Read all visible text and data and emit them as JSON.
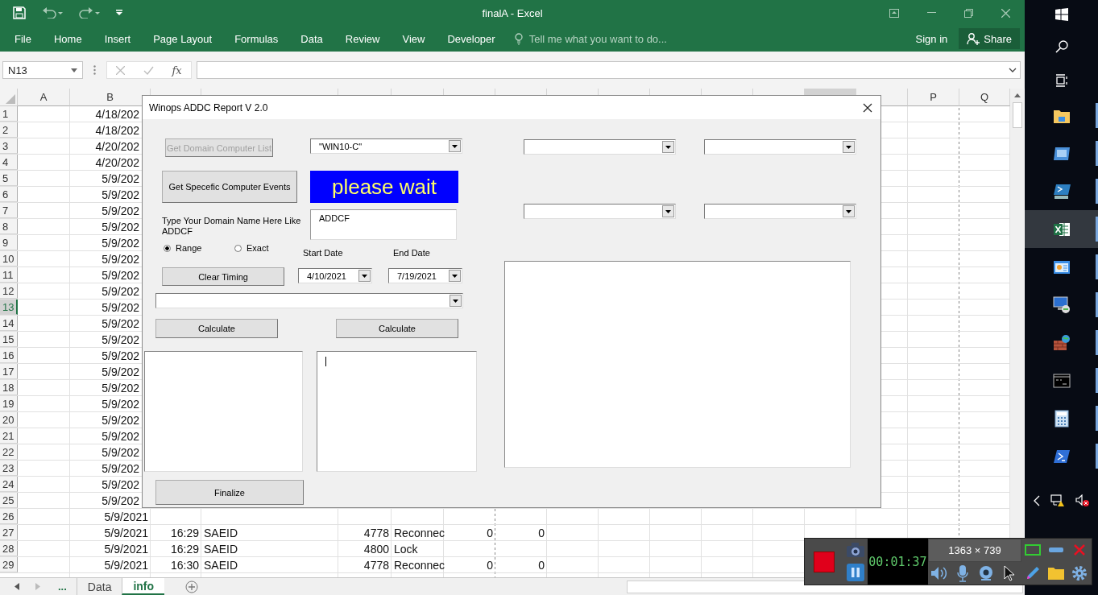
{
  "titlebar": {
    "title": "finalA - Excel"
  },
  "ribbon_tabs": [
    {
      "label": "File"
    },
    {
      "label": "Home"
    },
    {
      "label": "Insert"
    },
    {
      "label": "Page Layout"
    },
    {
      "label": "Formulas"
    },
    {
      "label": "Data"
    },
    {
      "label": "Review"
    },
    {
      "label": "View"
    },
    {
      "label": "Developer"
    }
  ],
  "tell_me": {
    "placeholder": "Tell me what you want to do..."
  },
  "account": {
    "sign_in": "Sign in",
    "share": "Share"
  },
  "formula_bar": {
    "name_box": "N13",
    "function_label": "fx"
  },
  "sheet": {
    "columns": [
      {
        "label": "A",
        "selected": false
      },
      {
        "label": "B",
        "selected": false
      },
      {
        "selected": false
      },
      {
        "selected": false
      },
      {
        "selected": false
      },
      {
        "selected": false
      },
      {
        "selected": false
      },
      {
        "selected": false
      },
      {
        "selected": false
      },
      {
        "selected": false
      },
      {
        "selected": false
      },
      {
        "selected": false
      },
      {
        "selected": false
      },
      {
        "selected": true
      },
      {
        "selected": false
      },
      {
        "label": "P",
        "selected": false
      },
      {
        "label": "Q",
        "selected": false
      }
    ],
    "rows": [
      {
        "number": "1",
        "selected": false,
        "cells": {
          "B": "4/18/202"
        }
      },
      {
        "number": "2",
        "selected": false,
        "cells": {
          "B": "4/18/202"
        }
      },
      {
        "number": "3",
        "selected": false,
        "cells": {
          "B": "4/20/202"
        }
      },
      {
        "number": "4",
        "selected": false,
        "cells": {
          "B": "4/20/202"
        }
      },
      {
        "number": "5",
        "selected": false,
        "cells": {
          "B": "5/9/202"
        }
      },
      {
        "number": "6",
        "selected": false,
        "cells": {
          "B": "5/9/202"
        }
      },
      {
        "number": "7",
        "selected": false,
        "cells": {
          "B": "5/9/202"
        }
      },
      {
        "number": "8",
        "selected": false,
        "cells": {
          "B": "5/9/202"
        }
      },
      {
        "number": "9",
        "selected": false,
        "cells": {
          "B": "5/9/202"
        }
      },
      {
        "number": "10",
        "selected": false,
        "cells": {
          "B": "5/9/202"
        }
      },
      {
        "number": "11",
        "selected": false,
        "cells": {
          "B": "5/9/202"
        }
      },
      {
        "number": "12",
        "selected": false,
        "cells": {
          "B": "5/9/202"
        }
      },
      {
        "number": "13",
        "selected": true,
        "cells": {
          "B": "5/9/202"
        }
      },
      {
        "number": "14",
        "selected": false,
        "cells": {
          "B": "5/9/202"
        }
      },
      {
        "number": "15",
        "selected": false,
        "cells": {
          "B": "5/9/202"
        }
      },
      {
        "number": "16",
        "selected": false,
        "cells": {
          "B": "5/9/202"
        }
      },
      {
        "number": "17",
        "selected": false,
        "cells": {
          "B": "5/9/202"
        }
      },
      {
        "number": "18",
        "selected": false,
        "cells": {
          "B": "5/9/202"
        }
      },
      {
        "number": "19",
        "selected": false,
        "cells": {
          "B": "5/9/202"
        }
      },
      {
        "number": "20",
        "selected": false,
        "cells": {
          "B": "5/9/202"
        }
      },
      {
        "number": "21",
        "selected": false,
        "cells": {
          "B": "5/9/202"
        }
      },
      {
        "number": "22",
        "selected": false,
        "cells": {
          "B": "5/9/202"
        }
      },
      {
        "number": "23",
        "selected": false,
        "cells": {
          "B": "5/9/202"
        }
      },
      {
        "number": "24",
        "selected": false,
        "cells": {
          "B": "5/9/202"
        }
      },
      {
        "number": "25",
        "selected": false,
        "cells": {
          "B": "5/9/202"
        }
      },
      {
        "number": "26",
        "selected": false,
        "cells": {
          "B": "5/9/2021"
        }
      },
      {
        "number": "27",
        "selected": false,
        "cells": {
          "B": "5/9/2021",
          "C": "16:29",
          "D": "SAEID",
          "E": "4778",
          "F": "Reconnec",
          "G": "0",
          "H": "0"
        }
      },
      {
        "number": "28",
        "selected": false,
        "cells": {
          "B": "5/9/2021",
          "C": "16:29",
          "D": "SAEID",
          "E": "4800",
          "F": "Lock"
        }
      },
      {
        "number": "29",
        "selected": false,
        "cells": {
          "B": "5/9/2021",
          "C": "16:30",
          "D": "SAEID",
          "E": "4778",
          "F": "Reconnec",
          "G": "0",
          "H": "0"
        }
      }
    ]
  },
  "sheet_tabs": {
    "more": "...",
    "tabs": [
      {
        "label": "Data",
        "selected": false
      },
      {
        "label": "info",
        "selected": true
      }
    ]
  },
  "dialog": {
    "title": "Winops ADDC Report V 2.0",
    "get_list_button": {
      "label": "Get Domain Computer List",
      "disabled": true
    },
    "computer_combo": {
      "value": "\"WIN10-C\""
    },
    "events_button": {
      "label": "Get Specefic Computer Events",
      "disabled": false
    },
    "status_label": "please wait",
    "domain_label": "Type Your Domain Name Here Like ADDCF",
    "domain_field": {
      "value": "ADDCF"
    },
    "match_options": [
      {
        "label": "Range",
        "selected": true
      },
      {
        "label": "Exact",
        "selected": false
      }
    ],
    "start_date_label": "Start Date",
    "end_date_label": "End Date",
    "clear_button": "Clear Timing",
    "start_date": {
      "value": "4/10/2021"
    },
    "end_date": {
      "value": "7/19/2021"
    },
    "calculate_buttons": [
      "Calculate",
      "Calculate"
    ],
    "finalize_button": "Finalize"
  },
  "taskbar": {
    "apps": [
      {
        "kind": "folder",
        "selected": false,
        "running": true
      },
      {
        "kind": "window",
        "selected": false,
        "running": true
      },
      {
        "kind": "powershell-dark",
        "selected": false,
        "running": true
      },
      {
        "kind": "excel",
        "selected": true,
        "running": true
      },
      {
        "kind": "presentation",
        "selected": false,
        "running": true
      },
      {
        "kind": "computer",
        "selected": false,
        "running": true
      },
      {
        "kind": "firewall",
        "selected": false,
        "running": true
      },
      {
        "kind": "console",
        "selected": false,
        "running": true
      },
      {
        "kind": "calculator",
        "selected": false,
        "running": true
      },
      {
        "kind": "powershell",
        "selected": false,
        "running": true
      }
    ]
  },
  "recorder": {
    "timer": "00:01:37",
    "resolution": "1363 × 739"
  }
}
